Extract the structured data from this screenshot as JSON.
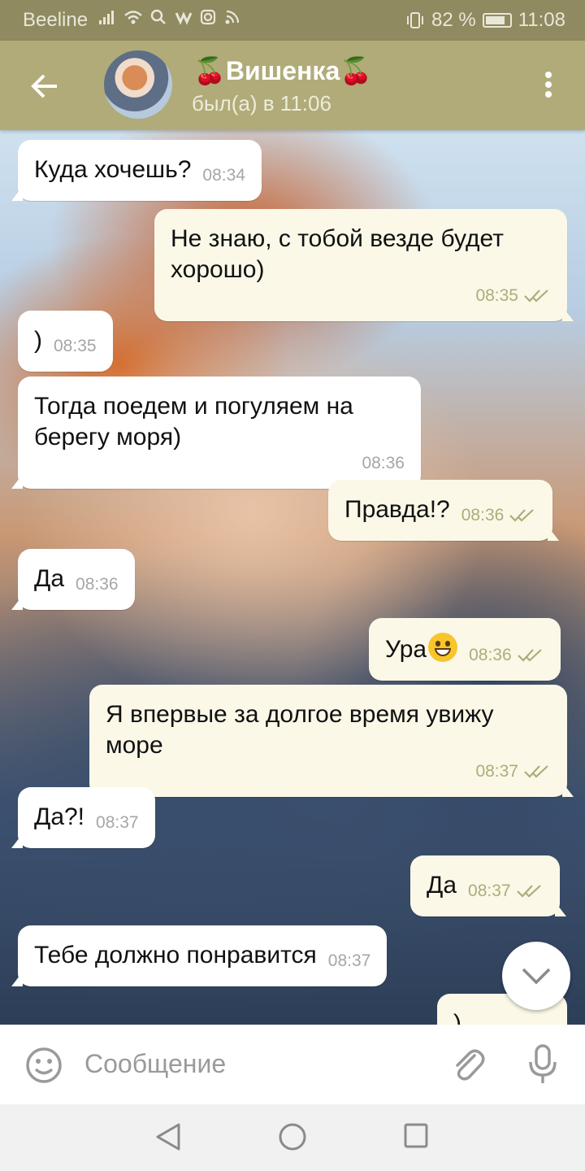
{
  "status_bar": {
    "carrier": "Beeline",
    "battery": "82 %",
    "battery_level": 0.82,
    "time": "11:08"
  },
  "header": {
    "back_icon": "arrow-left-icon",
    "title": "🍒Вишенка🍒",
    "subtitle": "был(а) в 11:06",
    "menu_icon": "more-vertical-icon"
  },
  "messages": [
    {
      "direction": "in",
      "text": "Куда хочешь?",
      "time": "08:34"
    },
    {
      "direction": "out",
      "text": "Не знаю, с тобой везде будет хорошо)",
      "time": "08:35",
      "read": true
    },
    {
      "direction": "in",
      "text": ")",
      "time": "08:35"
    },
    {
      "direction": "in",
      "text": "Тогда поедем и погуляем на берегу моря)",
      "time": "08:36"
    },
    {
      "direction": "out",
      "text": "Правда!?",
      "time": "08:36",
      "read": true
    },
    {
      "direction": "in",
      "text": "Да",
      "time": "08:36"
    },
    {
      "direction": "out",
      "text": "Ура",
      "emoji": "grinning-face-icon",
      "time": "08:36",
      "read": true
    },
    {
      "direction": "out",
      "text": "Я впервые за долгое время увижу море",
      "time": "08:37",
      "read": true
    },
    {
      "direction": "in",
      "text": "Да?!",
      "time": "08:37"
    },
    {
      "direction": "out",
      "text": "Да",
      "time": "08:37",
      "read": true
    },
    {
      "direction": "in",
      "text": "Тебе должно понравится",
      "time": "08:37"
    },
    {
      "direction": "out",
      "text": ")",
      "time": "",
      "read": true
    }
  ],
  "input": {
    "placeholder": "Сообщение",
    "emoji_icon": "smile-icon",
    "attach_icon": "paperclip-icon",
    "mic_icon": "microphone-icon"
  },
  "scroll_button_icon": "chevron-down-icon",
  "nav_icons": [
    "back-triangle-icon",
    "home-circle-icon",
    "recents-square-icon"
  ],
  "colors": {
    "header": "#b0ab79",
    "status_bar": "#8f8a60",
    "outgoing_bubble": "#fbf8e8",
    "incoming_bubble": "#ffffff",
    "tick": "#b0ab7a"
  }
}
